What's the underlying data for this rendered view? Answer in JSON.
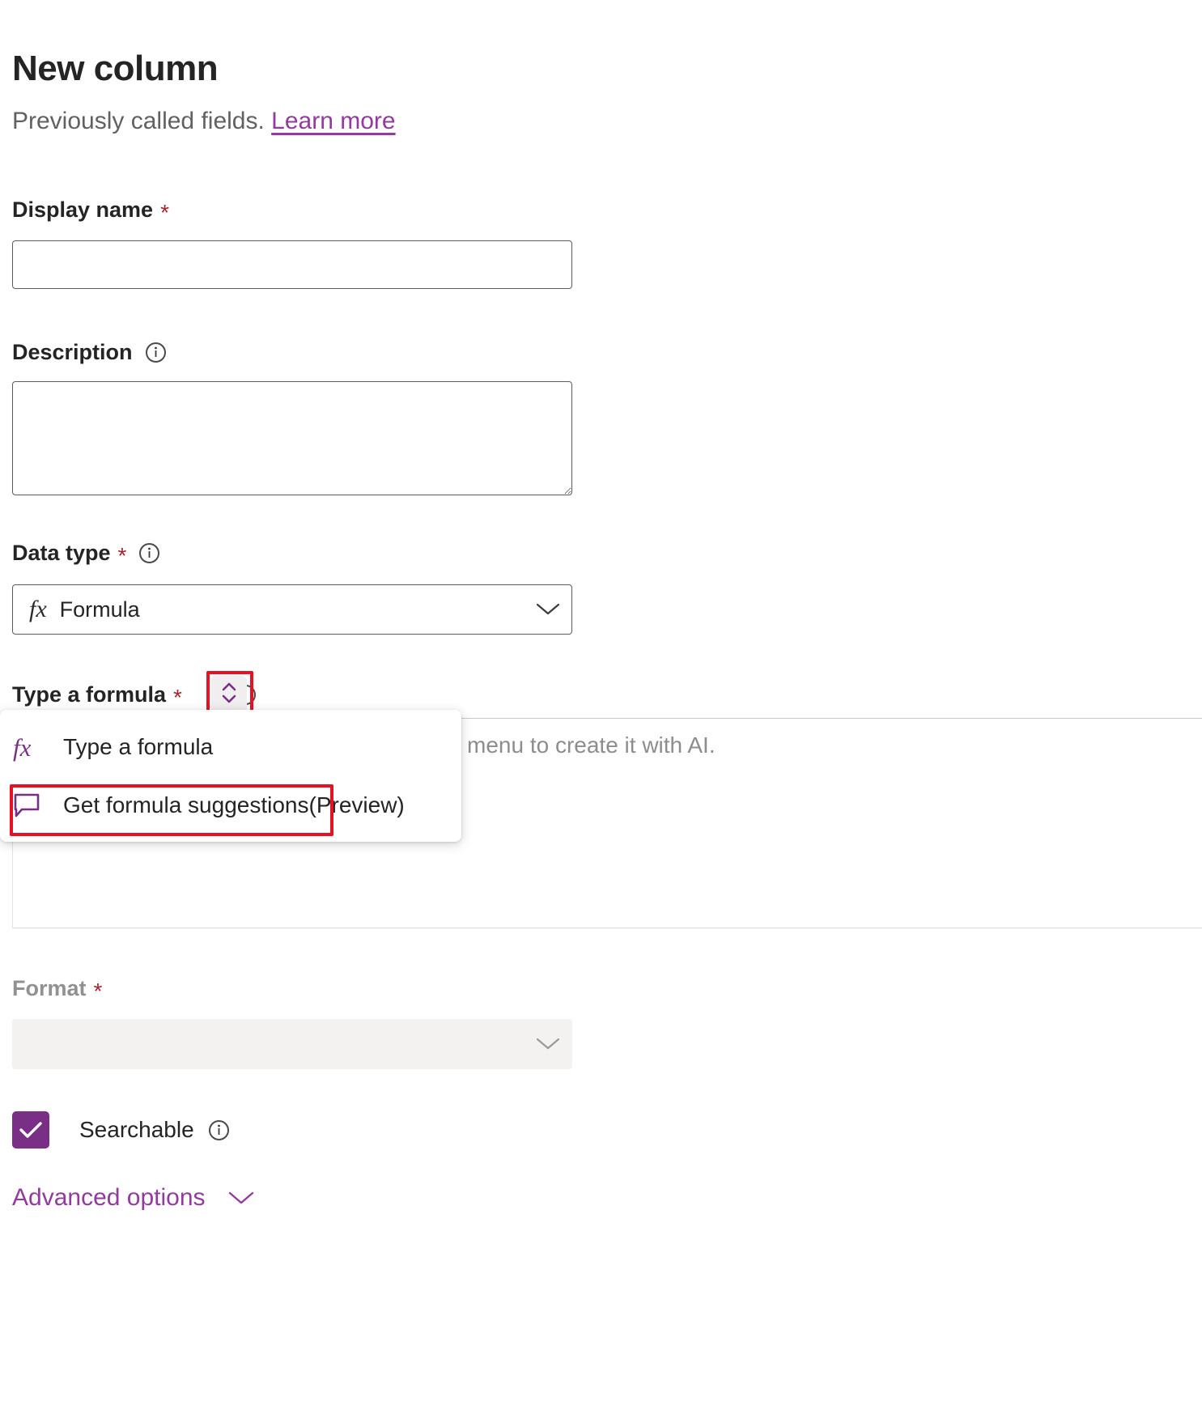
{
  "header": {
    "title": "New column",
    "subtitle_text": "Previously called fields.",
    "learn_more": "Learn more"
  },
  "fields": {
    "display_name": {
      "label": "Display name",
      "required_marker": "*",
      "value": "",
      "placeholder": ""
    },
    "description": {
      "label": "Description",
      "info_icon": "info-icon",
      "value": "",
      "placeholder": ""
    },
    "data_type": {
      "label": "Data type",
      "required_marker": "*",
      "info_icon": "info-icon",
      "selected_icon": "fx-icon",
      "selected_value": "Formula",
      "chevron": "chevron-down-icon"
    },
    "type_a_formula": {
      "label": "Type a formula",
      "required_marker": "*",
      "spinner_icon": "chevron-up-down-icon",
      "info_icon": "info-icon",
      "editor_placeholder": "menu to create it with AI."
    },
    "format": {
      "label": "Format",
      "required_marker": "*",
      "selected_value": "",
      "chevron": "chevron-down-icon",
      "disabled": true
    },
    "searchable": {
      "label": "Searchable",
      "checked": true,
      "check_icon": "checkmark-icon",
      "info_icon": "info-icon"
    },
    "advanced_options": {
      "label": "Advanced options",
      "chevron": "chevron-down-icon"
    }
  },
  "formula_menu": {
    "items": [
      {
        "icon": "fx-icon",
        "label": "Type a formula",
        "suffix": ""
      },
      {
        "icon": "comment-icon",
        "label": "Get formula suggestions",
        "suffix": " (Preview)"
      }
    ]
  },
  "colors": {
    "accent_purple": "#7a2f86",
    "link_purple": "#923a9e",
    "required_red": "#a4262c",
    "annotation_red": "#e81123",
    "disabled_bg": "#f3f2f1",
    "text_primary": "#242424",
    "text_secondary": "#616161",
    "placeholder": "#8d8d8d"
  }
}
